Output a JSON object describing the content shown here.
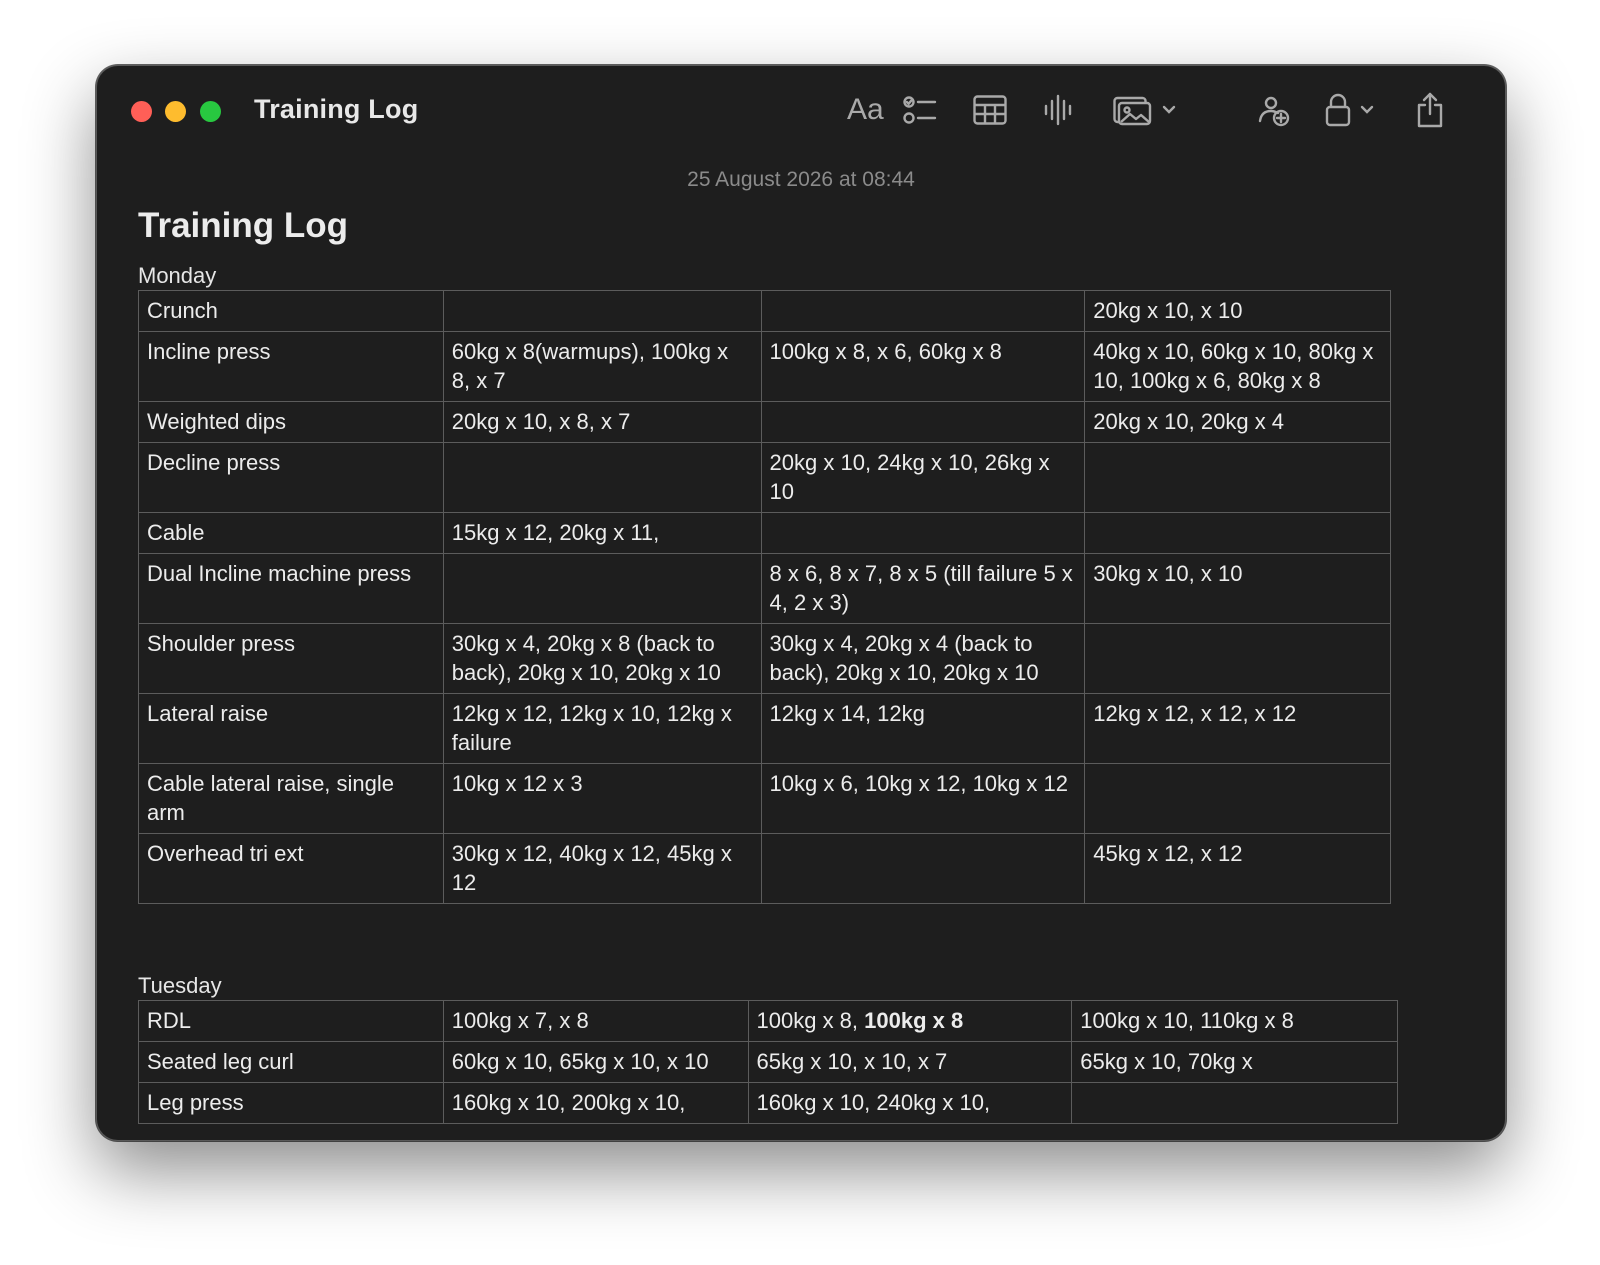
{
  "window": {
    "title": "Training Log"
  },
  "toolbar": {
    "format_label": "Aa",
    "icons": [
      "format-icon",
      "checklist-icon",
      "table-icon",
      "audio-icon",
      "media-icon",
      "collaborate-icon",
      "lock-icon",
      "share-icon"
    ]
  },
  "note": {
    "timestamp": "25 August 2026 at 08:44",
    "title": "Training Log",
    "days": [
      {
        "label": "Monday",
        "rows": [
          [
            "Crunch",
            "",
            "",
            "20kg x 10, x 10"
          ],
          [
            "Incline press",
            "60kg x 8(warmups), 100kg x 8, x 7",
            "100kg x 8, x 6, 60kg x 8",
            "40kg x 10, 60kg x 10, 80kg x 10, 100kg x 6, 80kg x 8"
          ],
          [
            "Weighted dips",
            "20kg x 10, x 8, x 7",
            "",
            "20kg x 10, 20kg x 4"
          ],
          [
            "Decline press",
            "",
            "20kg x 10, 24kg x 10, 26kg x 10",
            ""
          ],
          [
            "Cable",
            "15kg x 12, 20kg x 11,",
            "",
            ""
          ],
          [
            "Dual Incline machine press",
            "",
            "8 x 6, 8 x 7, 8 x 5 (till failure 5 x 4, 2 x 3)",
            "30kg x 10, x 10"
          ],
          [
            "Shoulder press",
            "30kg x 4, 20kg x 8 (back to back), 20kg x 10, 20kg x 10",
            "30kg x 4, 20kg x 4 (back to back), 20kg x 10, 20kg x 10",
            ""
          ],
          [
            "Lateral raise",
            "12kg x 12, 12kg x 10, 12kg x failure",
            "12kg x 14, 12kg",
            "12kg x 12, x 12, x 12"
          ],
          [
            "Cable lateral raise, single arm",
            "10kg x 12 x 3",
            "10kg x 6, 10kg x 12, 10kg x 12",
            ""
          ],
          [
            "Overhead tri ext",
            "30kg x 12, 40kg x 12, 45kg x 12",
            "",
            "45kg x 12, x 12"
          ]
        ]
      },
      {
        "label": "Tuesday",
        "rows": [
          [
            "RDL",
            "100kg x 7, x 8",
            "100kg x 8, ",
            "100kg x 10, 110kg x 8"
          ],
          [
            "Seated leg curl",
            "60kg x 10, 65kg x 10, x 10",
            "65kg x 10, x 10, x 7",
            "65kg x 10, 70kg x"
          ],
          [
            "Leg press",
            "160kg x 10, 200kg x 10,",
            "160kg x 10, 240kg x 10,",
            ""
          ]
        ],
        "bold_fragment": "100kg x 8"
      }
    ]
  }
}
